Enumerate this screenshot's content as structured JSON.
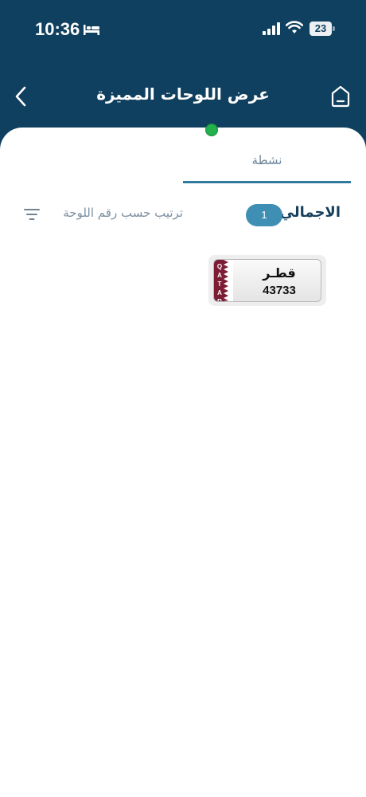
{
  "status_bar": {
    "time": "10:36",
    "battery_level": "23",
    "icons": [
      "bed-icon",
      "signal-icon",
      "wifi-icon",
      "battery-icon"
    ]
  },
  "nav": {
    "title": "عرض اللوحات المميزة",
    "back_icon": "chevron-left-icon",
    "home_icon": "home-icon"
  },
  "tabs": [
    {
      "label": "نشطة",
      "active": true
    }
  ],
  "summary": {
    "total_label": "الاجمالي",
    "total_count": "1",
    "sort_label": "ترتيب حسب رقم اللوحة",
    "sort_icon": "filter-lines-icon"
  },
  "plates": [
    {
      "country": "قطـر",
      "number": "43733",
      "flag_text": "Q\nA\nT\nA\nR",
      "status_color": "#22b14c"
    }
  ],
  "colors": {
    "header": "#10405f",
    "accent": "#3f8fb5",
    "flag": "#7c1d35",
    "active_status": "#22b14c"
  }
}
